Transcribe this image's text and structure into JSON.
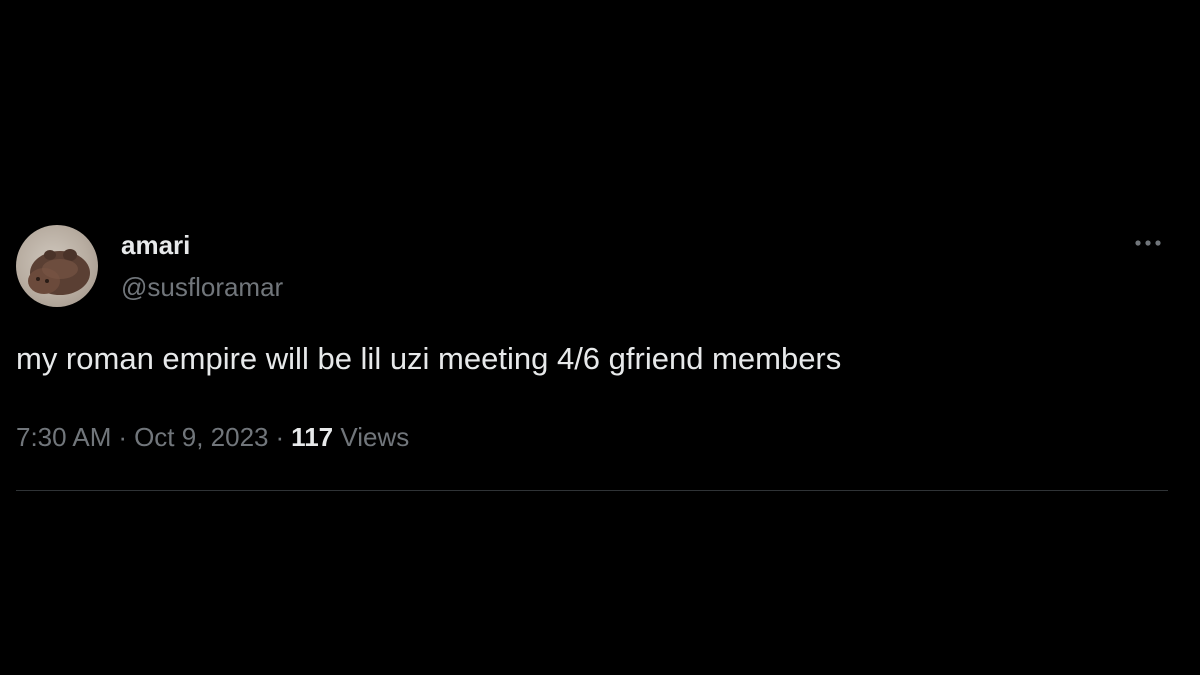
{
  "tweet": {
    "author": {
      "display_name": "amari",
      "handle": "@susfloramar",
      "avatar": "hippo-figurine-avatar"
    },
    "text": "my roman empire will be lil uzi meeting 4/6 gfriend members",
    "time": "7:30 AM",
    "separator": "·",
    "date": "Oct 9, 2023",
    "views_count": "117",
    "views_label": "Views",
    "more_icon": "more-horizontal-icon"
  },
  "colors": {
    "background": "#000000",
    "primary_text": "#e7e9ea",
    "secondary_text": "#71767b",
    "divider": "#2f3336"
  }
}
